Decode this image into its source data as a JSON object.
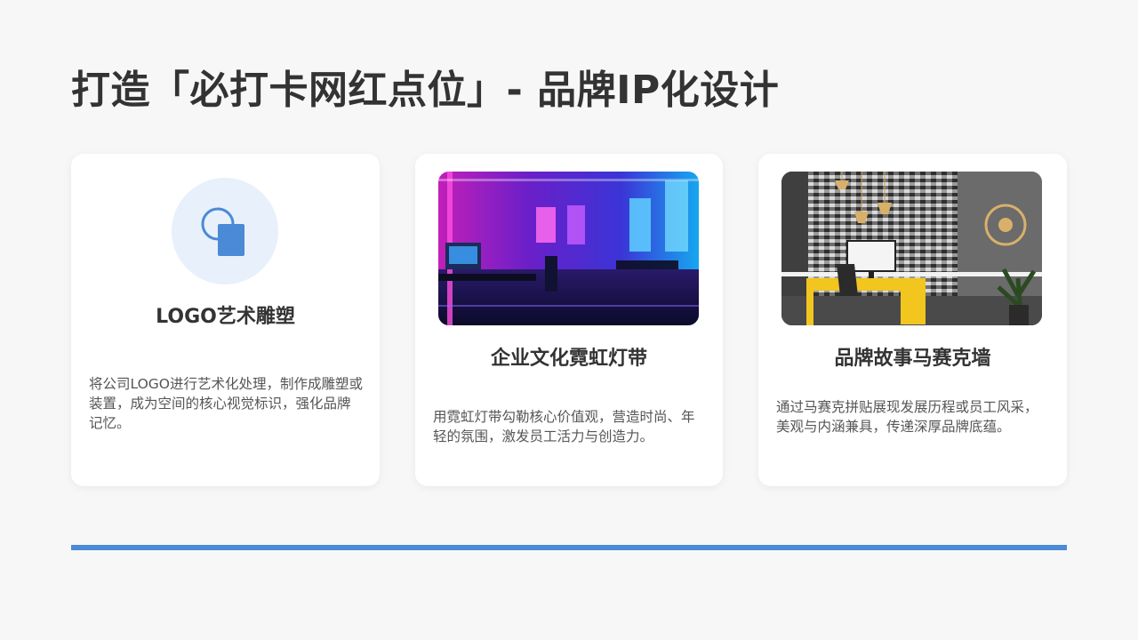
{
  "page": {
    "title": "打造「必打卡网红点位」- 品牌IP化设计"
  },
  "cards": [
    {
      "title": "LOGO艺术雕塑",
      "description": "将公司LOGO进行艺术化处理，制作成雕塑或装置，成为空间的核心视觉标识，强化品牌记忆。",
      "icon": "shapes-icon"
    },
    {
      "title": "企业文化霓虹灯带",
      "description": "用霓虹灯带勾勒核心价值观，营造时尚、年轻的氛围，激发员工活力与创造力。"
    },
    {
      "title": "品牌故事马赛克墙",
      "description": "通过马赛克拼贴展现发展历程或员工风采，美观与内涵兼具，传递深厚品牌底蕴。"
    }
  ],
  "colors": {
    "accent": "#4a8ad6",
    "icon_bg": "#e8f0fb",
    "title": "#333333",
    "text": "#555555",
    "background": "#f7f7f7"
  }
}
